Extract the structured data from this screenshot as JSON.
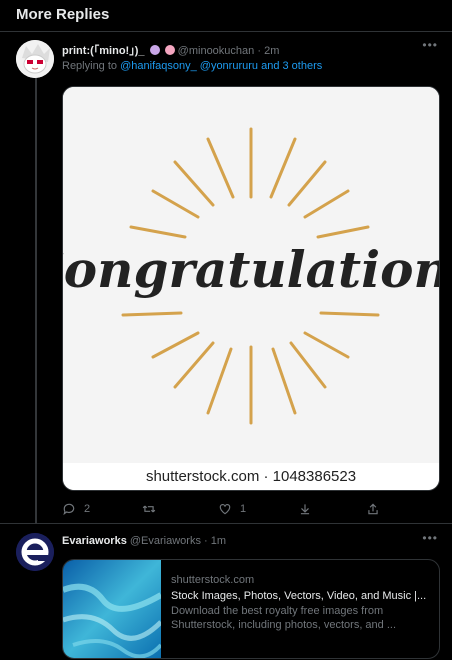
{
  "header": {
    "title": "More Replies"
  },
  "tweets": [
    {
      "name": "print:(「mino!」)_",
      "handle": "@minookuchan",
      "separator": "·",
      "time": "2m",
      "replying_prefix": "Replying to",
      "replying_mentions": "@hanifaqsony_ @yonrururu",
      "replying_suffix": "and 3 others",
      "media": {
        "art_text": "Congratulations",
        "caption": "shutterstock.com · 1048386523"
      },
      "actions": {
        "replies": "2",
        "retweets": "",
        "likes": "1"
      }
    },
    {
      "name": "Evariaworks",
      "handle": "@Evariaworks",
      "separator": "·",
      "time": "1m",
      "card": {
        "domain": "shutterstock.com",
        "title": "Stock Images, Photos, Vectors, Video, and Music |...",
        "description": "Download the best royalty free images from Shutterstock, including photos, vectors, and ..."
      }
    }
  ],
  "icons": {
    "more": "more-icon",
    "reply": "reply-icon",
    "retweet": "retweet-icon",
    "like": "like-icon",
    "download": "download-icon",
    "share": "share-icon"
  },
  "colors": {
    "background": "#000000",
    "accent": "#1d9bf0",
    "muted": "#71767b",
    "border": "#2f3336",
    "gold": "#d4a24c"
  }
}
